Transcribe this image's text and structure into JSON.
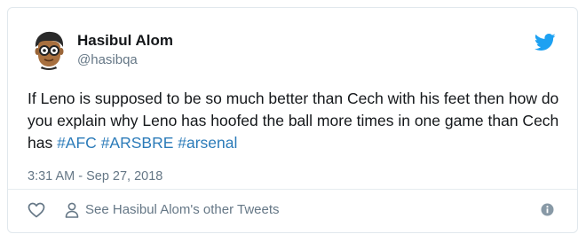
{
  "author": {
    "name": "Hasibul Alom",
    "handle": "@hasibqa"
  },
  "tweet": {
    "text_plain": "If Leno is supposed to be so much better than Cech with his feet then how do you explain why Leno has hoofed the ball more times in one game than Cech has ",
    "hashtags": [
      "#AFC",
      "#ARSBRE",
      "#arsenal"
    ],
    "timestamp": "3:31 AM - Sep 27, 2018"
  },
  "actions": {
    "other_tweets_label": "See Hasibul Alom's other Tweets"
  },
  "icons": {
    "brand": "twitter-bird-icon",
    "like": "heart-icon",
    "profile": "person-icon",
    "info": "info-icon"
  },
  "colors": {
    "brand_blue": "#1da1f2",
    "hashtag_blue": "#2b7bb9",
    "text": "#14171a",
    "secondary_text": "#657786",
    "border": "#e1e8ed"
  }
}
